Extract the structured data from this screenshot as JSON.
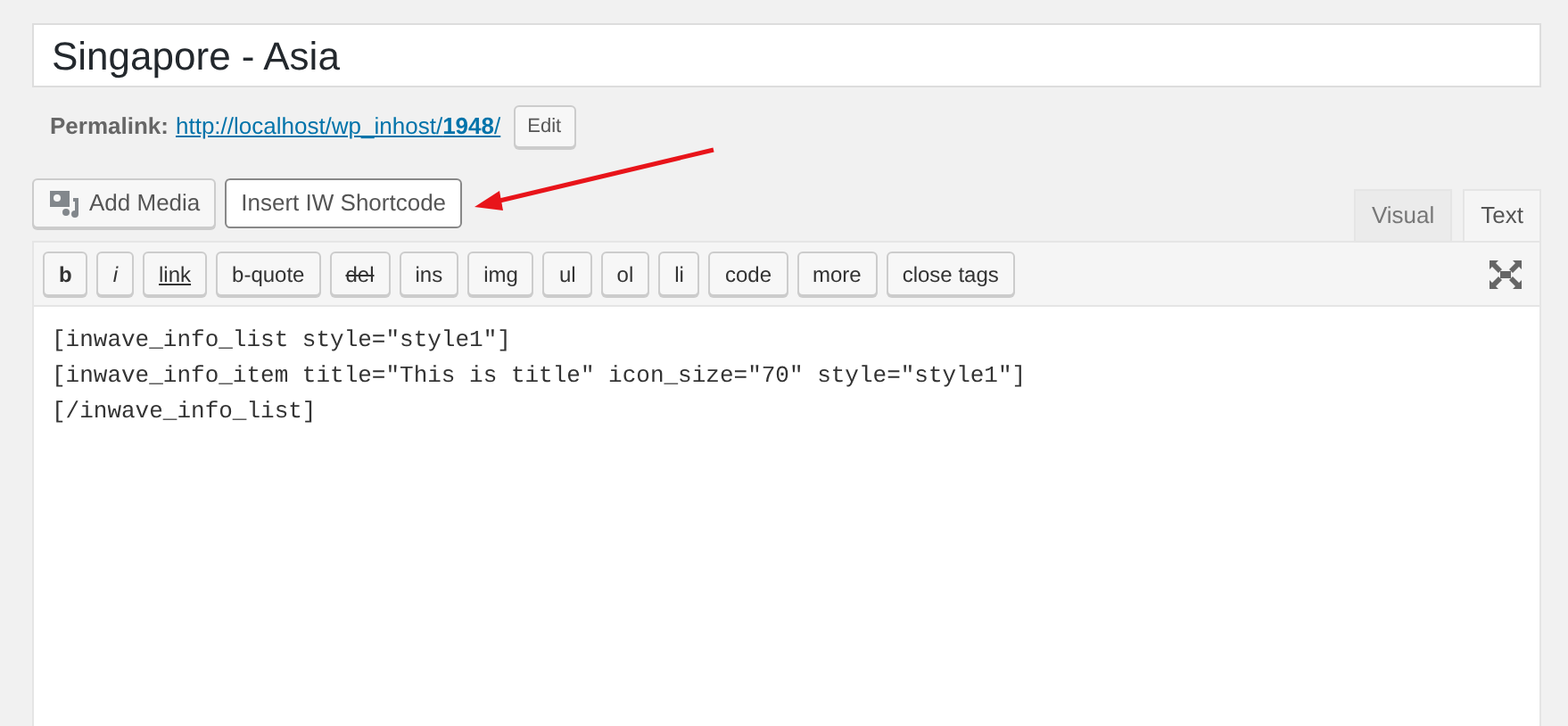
{
  "title_field": {
    "value": "Singapore - Asia"
  },
  "permalink": {
    "label": "Permalink:",
    "url_start": "http://localhost/wp_inhost/",
    "url_slug": "1948",
    "url_end": "/",
    "edit_button": "Edit"
  },
  "media_buttons": [
    {
      "label": "Add Media",
      "kind": "media"
    },
    {
      "label": "Insert IW Shortcode",
      "kind": "plain"
    }
  ],
  "editor_tabs": [
    {
      "label": "Visual",
      "selected": false
    },
    {
      "label": "Text",
      "selected": true
    }
  ],
  "quicktags": [
    {
      "label": "b",
      "kind": "bold"
    },
    {
      "label": "i",
      "kind": "italic"
    },
    {
      "label": "link",
      "kind": "underline"
    },
    {
      "label": "b-quote",
      "kind": "plain"
    },
    {
      "label": "del",
      "kind": "strike"
    },
    {
      "label": "ins",
      "kind": "plain"
    },
    {
      "label": "img",
      "kind": "plain"
    },
    {
      "label": "ul",
      "kind": "plain"
    },
    {
      "label": "ol",
      "kind": "plain"
    },
    {
      "label": "li",
      "kind": "plain"
    },
    {
      "label": "code",
      "kind": "plain"
    },
    {
      "label": "more",
      "kind": "plain"
    },
    {
      "label": "close tags",
      "kind": "plain"
    }
  ],
  "editor_lines": [
    "[inwave_info_list style=\"style1\"]",
    "[inwave_info_item title=\"This is title\" icon_size=\"70\" style=\"style1\"]",
    "[/inwave_info_list]"
  ]
}
